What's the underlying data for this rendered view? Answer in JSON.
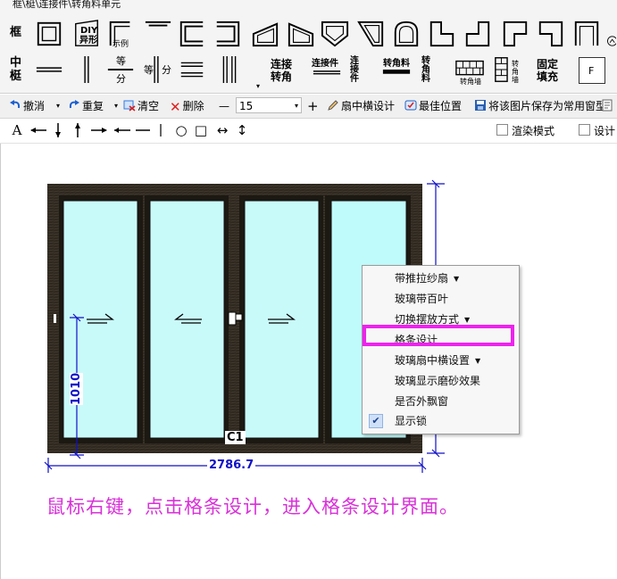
{
  "ribbon": {
    "title": "框\\梃\\连接件\\转角料单元",
    "row1_label": "框",
    "row2_label_top": "中",
    "row2_label_bottom": "梃",
    "diy_label_1": "DIY",
    "diy_label_2": "异形",
    "custom_label": "示例",
    "equal_top": "等",
    "equal_bottom": "分",
    "equal_side_1": "等",
    "equal_side_2": "分",
    "connect_corner_1": "连接",
    "connect_corner_2": "转角",
    "connector_label": "连接件",
    "connector_vertical": "连接件",
    "corner_material": "转角料",
    "corner_material_vertical": "转角料",
    "corner_wall_1": "转角墙",
    "corner_wall_2": "转角墙",
    "fixed_fill_1": "固定",
    "fixed_fill_2": "填充",
    "f_button": "F"
  },
  "toolbar": {
    "undo": "撤消",
    "redo": "重复",
    "clear": "清空",
    "delete": "删除",
    "minus": "—",
    "zoom_value": "15",
    "plus": "+",
    "sash_transom": "扇中横设计",
    "best_position": "最佳位置",
    "save_image": "将该图片保存为常用窗型"
  },
  "drawbar": {
    "text_tool": "A",
    "circle_tool": "○",
    "rect_tool": "□",
    "hdim_tool": "↔",
    "vdim_tool": "↕",
    "render_mode": "渲染模式",
    "settings": "设计"
  },
  "drawing": {
    "width_dim": "2786.7",
    "height_dim": "1010",
    "window_label": "C1"
  },
  "context_menu": {
    "items": [
      {
        "label": "带推拉纱扇",
        "submenu": true
      },
      {
        "label": "玻璃带百叶",
        "submenu": false
      },
      {
        "label": "切换摆放方式",
        "submenu": true
      },
      {
        "label": "格条设计",
        "submenu": false,
        "highlighted": true
      },
      {
        "label": "玻璃扇中横设置",
        "submenu": true
      },
      {
        "label": "玻璃显示磨砂效果",
        "submenu": false
      },
      {
        "label": "是否外飘窗",
        "submenu": false
      },
      {
        "label": "显示锁",
        "submenu": false,
        "checked": true
      }
    ]
  },
  "instruction": "鼠标右键，点击格条设计，进入格条设计界面。",
  "colors": {
    "frame": "#2e2820",
    "glass": "#c9fafa",
    "highlight": "#ee22ee",
    "dimension": "#1010c8",
    "instruction": "#d832d8"
  }
}
